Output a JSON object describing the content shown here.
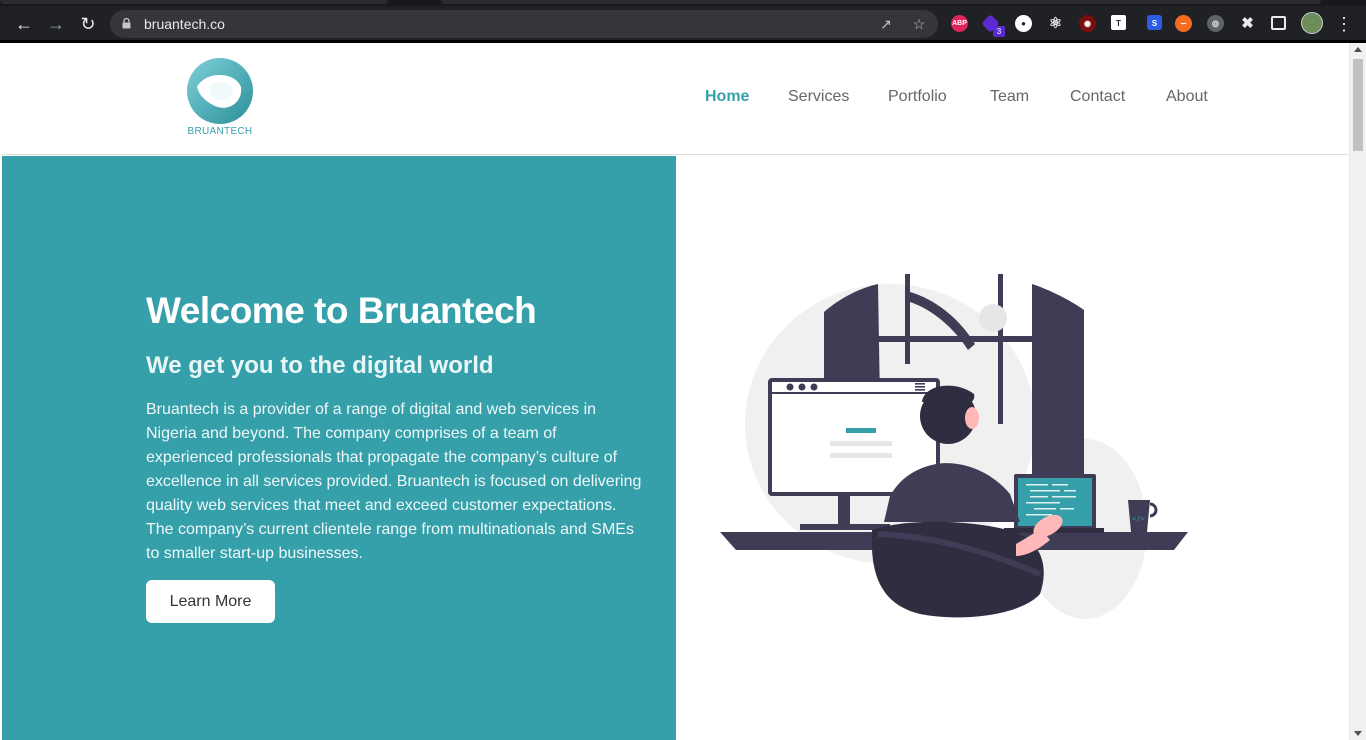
{
  "browser": {
    "url": "bruantech.co",
    "extensions": [
      "ABP",
      "3"
    ]
  },
  "header": {
    "logo_text": "BRUANTECH",
    "nav": [
      {
        "label": "Home",
        "active": true
      },
      {
        "label": "Services"
      },
      {
        "label": "Portfolio"
      },
      {
        "label": "Team"
      },
      {
        "label": "Contact"
      },
      {
        "label": "About"
      }
    ]
  },
  "hero": {
    "title": "Welcome to Bruantech",
    "subtitle": "We get you to the digital world",
    "body": "Bruantech is a provider of a range of digital and web services in Nigeria and beyond. The company comprises of a team of experienced professionals that propagate the company’s culture of excellence in all services provided. Bruantech is focused on delivering quality web services that meet and exceed customer expectations. The company’s current clientele range from multinationals and SMEs to smaller start-up businesses.",
    "cta_label": "Learn More"
  },
  "colors": {
    "brand": "#35a0aa",
    "ink": "#3f3d56"
  }
}
